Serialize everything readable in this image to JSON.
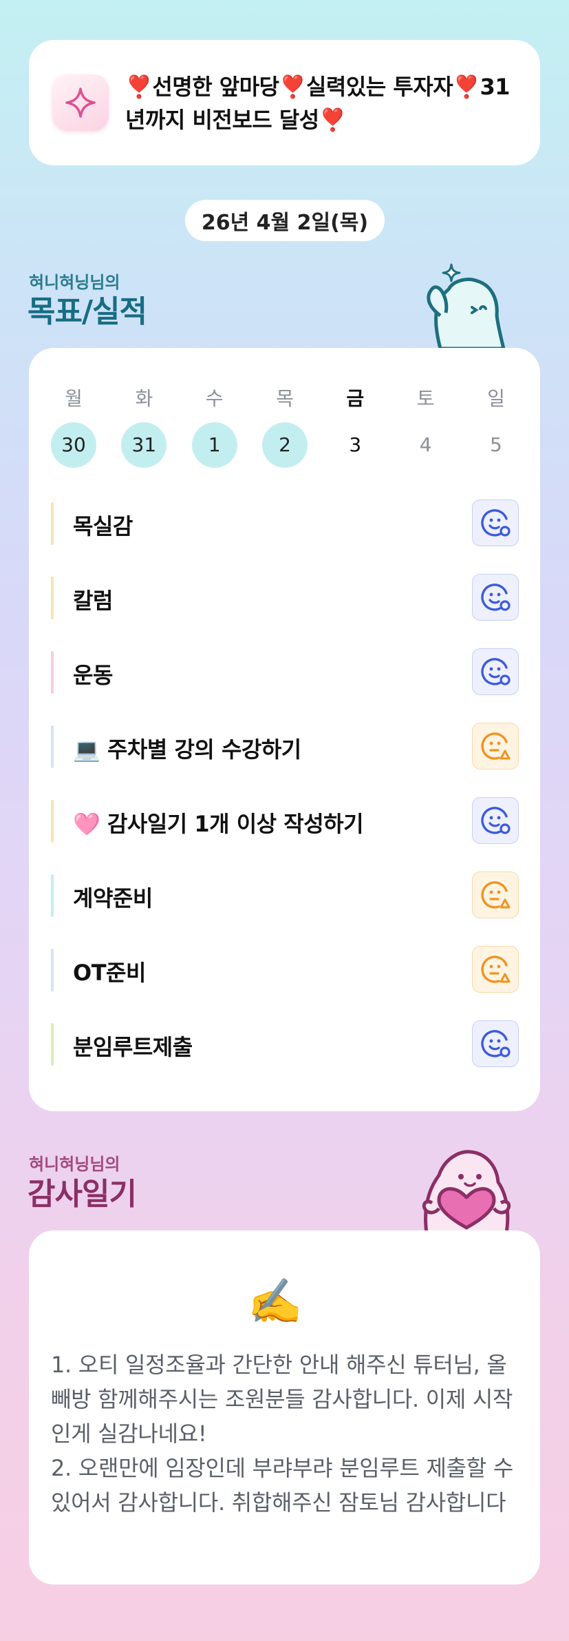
{
  "vision": {
    "text": "❣️선명한 앞마당❣️실력있는 투자자❣️31년까지 비전보드 달성❣️",
    "icon": "sparkle-icon"
  },
  "date": "26년 4월 2일(목)",
  "goals_section": {
    "small": "혀니혀닝님의",
    "big": "목표/실적"
  },
  "week": {
    "weekdays": [
      "월",
      "화",
      "수",
      "목",
      "금",
      "토",
      "일"
    ],
    "days": [
      "30",
      "31",
      "1",
      "2",
      "3",
      "4",
      "5"
    ],
    "completed_days": [
      "30",
      "31",
      "1",
      "2"
    ],
    "today_index": 4
  },
  "goals": [
    {
      "label": "목실감",
      "bar_color": "#f9e3b3",
      "status": "good",
      "icon": "smile-face-icon"
    },
    {
      "label": "칼럼",
      "bar_color": "#f9e3b3",
      "status": "good",
      "icon": "smile-face-icon"
    },
    {
      "label": "운동",
      "bar_color": "#f6cce3",
      "status": "good",
      "icon": "smile-face-icon"
    },
    {
      "label": "💻 주차별 강의 수강하기",
      "bar_color": "#d6e4f0",
      "status": "partial",
      "icon": "neutral-face-icon"
    },
    {
      "label": "🩷 감사일기 1개 이상 작성하기",
      "bar_color": "#f9e3b3",
      "status": "good",
      "icon": "smile-face-icon"
    },
    {
      "label": "계약준비",
      "bar_color": "#c6eef0",
      "status": "partial",
      "icon": "neutral-face-icon"
    },
    {
      "label": "OT준비",
      "bar_color": "#d6e4f0",
      "status": "partial",
      "icon": "neutral-face-icon"
    },
    {
      "label": "분임루트제출",
      "bar_color": "#d8efb8",
      "status": "good",
      "icon": "smile-face-icon"
    }
  ],
  "thanks_section": {
    "small": "혀니혀닝님의",
    "big": "감사일기"
  },
  "thanks": {
    "icon": "✍️",
    "lines": [
      "1. 오티 일정조율과 간단한 안내 해주신 튜터님, 올빼방 함께해주시는 조원분들 감사합니다. 이제 시작인게 실감나네요!",
      "2. 오랜만에 임장인데 부랴부랴 분임루트 제출할 수 있어서 감사합니다. 취합해주신 잠토님 감사합니다"
    ]
  },
  "colors": {
    "good": "#3b5bdb",
    "partial": "#f0931e",
    "done_day_bg": "#c3eef0",
    "goals_title": "#176d84",
    "thanks_title": "#8b2f66"
  }
}
